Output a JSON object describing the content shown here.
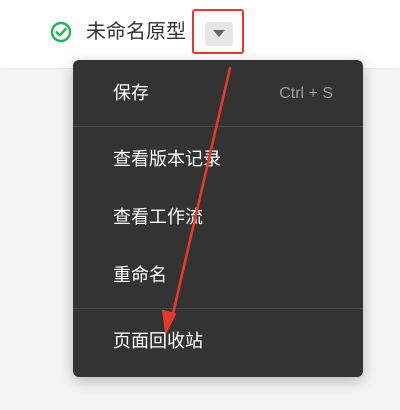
{
  "header": {
    "title": "未命名原型",
    "status_icon": "check-circle-icon",
    "dropdown_icon": "caret-down-icon"
  },
  "menu": {
    "items": [
      {
        "label": "保存",
        "shortcut": "Ctrl + S"
      },
      {
        "label": "查看版本记录"
      },
      {
        "label": "查看工作流"
      },
      {
        "label": "重命名"
      },
      {
        "label": "页面回收站"
      }
    ]
  },
  "colors": {
    "status_green": "#1fb55c",
    "menu_bg": "#333333",
    "highlight_red": "#e8382c"
  }
}
